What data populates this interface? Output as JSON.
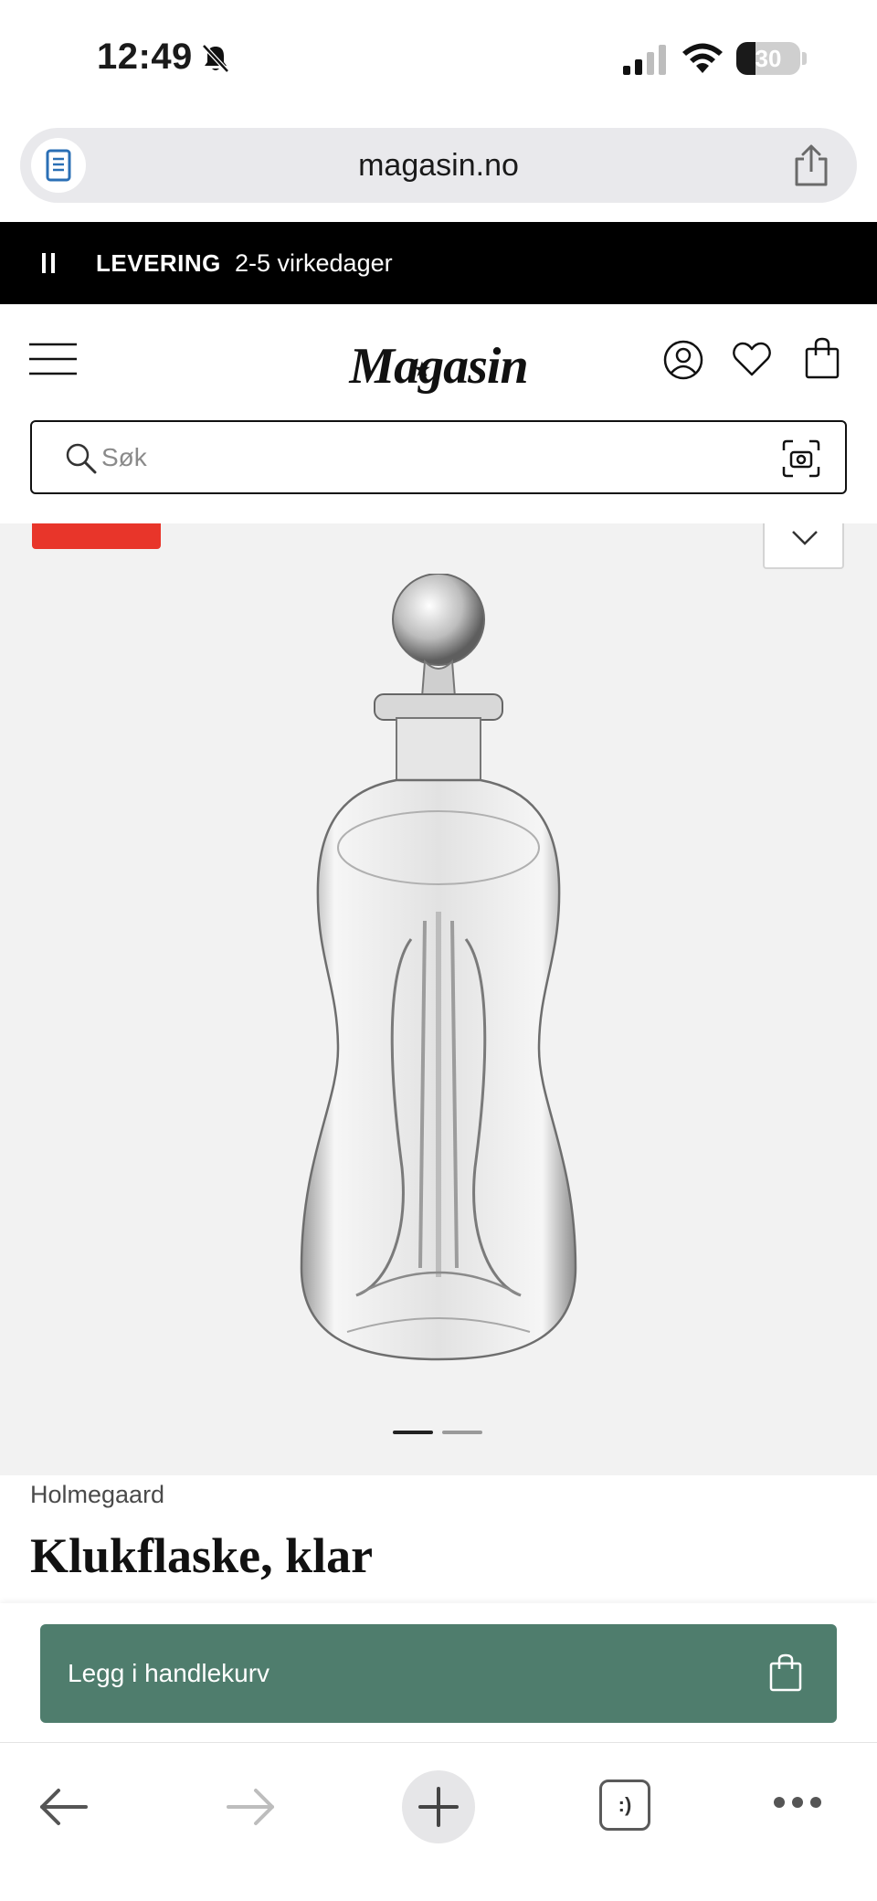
{
  "status_bar": {
    "time": "12:49",
    "battery": "30",
    "battery_level": 0.3
  },
  "browser": {
    "url": "magasin.no"
  },
  "banner": {
    "label": "LEVERING",
    "value": "2-5 virkedager"
  },
  "header": {
    "logo": "Magasin"
  },
  "search": {
    "placeholder": "Søk",
    "value": ""
  },
  "product": {
    "brand": "Holmegaard",
    "title": "Klukflaske, klar",
    "gallery_count": 2,
    "active_image": 1
  },
  "cart": {
    "add_label": "Legg i handlekurv"
  },
  "toolbar": {
    "tabs_label": ":)"
  },
  "colors": {
    "banner_bg": "#000000",
    "badge": "#e8352a",
    "cart_button": "#4f7d6d",
    "gallery_bg": "#f2f2f2"
  },
  "icons": {
    "status": [
      "bell-slash-icon",
      "signal-icon",
      "wifi-icon",
      "battery-icon"
    ],
    "browser": [
      "reader-icon",
      "share-icon"
    ],
    "header": [
      "menu-icon",
      "account-icon",
      "heart-icon",
      "shopping-bag-icon"
    ],
    "search": [
      "search-icon",
      "camera-scan-icon"
    ],
    "toolbar": [
      "back-arrow-icon",
      "forward-arrow-icon",
      "plus-icon",
      "tabs-icon",
      "more-icon"
    ]
  }
}
